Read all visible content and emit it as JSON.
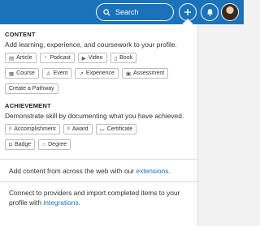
{
  "header": {
    "search_label": "Search",
    "search_icon": "search-icon",
    "add_icon": "plus-icon",
    "bell_icon": "bell-icon",
    "accent": "#1a73b9"
  },
  "content": {
    "title": "CONTENT",
    "description": "Add learning, experience, and coursework to your profile.",
    "row1": [
      {
        "label": "Article",
        "icon": "▤"
      },
      {
        "label": "Podcast",
        "icon": "♀"
      },
      {
        "label": "Video",
        "icon": "▶"
      },
      {
        "label": "Book",
        "icon": "▯"
      }
    ],
    "row2": [
      {
        "label": "Course",
        "icon": "▦"
      },
      {
        "label": "Event",
        "icon": "♙"
      },
      {
        "label": "Experience",
        "icon": "↗"
      },
      {
        "label": "Assessment",
        "icon": "▣"
      }
    ],
    "row3": [
      {
        "label": "Create a Pathway"
      }
    ]
  },
  "achievement": {
    "title": "ACHIEVEMENT",
    "description": "Demonstrate skill by documenting what you have achieved.",
    "row1": [
      {
        "label": "Accomplishment",
        "icon": "‼"
      },
      {
        "label": "Award",
        "icon": "‼"
      },
      {
        "label": "Certificate",
        "icon": "▭"
      }
    ],
    "row2": [
      {
        "label": "Badge",
        "icon": "◘"
      },
      {
        "label": "Degree",
        "icon": "⌂"
      }
    ]
  },
  "footer": {
    "extensions_prefix": "Add content from across the web with our ",
    "extensions_link": "extensions",
    "extensions_suffix": ".",
    "integrations_prefix": "Connect to providers and import completed items to your profile with ",
    "integrations_link": "integrations",
    "integrations_suffix": "."
  }
}
